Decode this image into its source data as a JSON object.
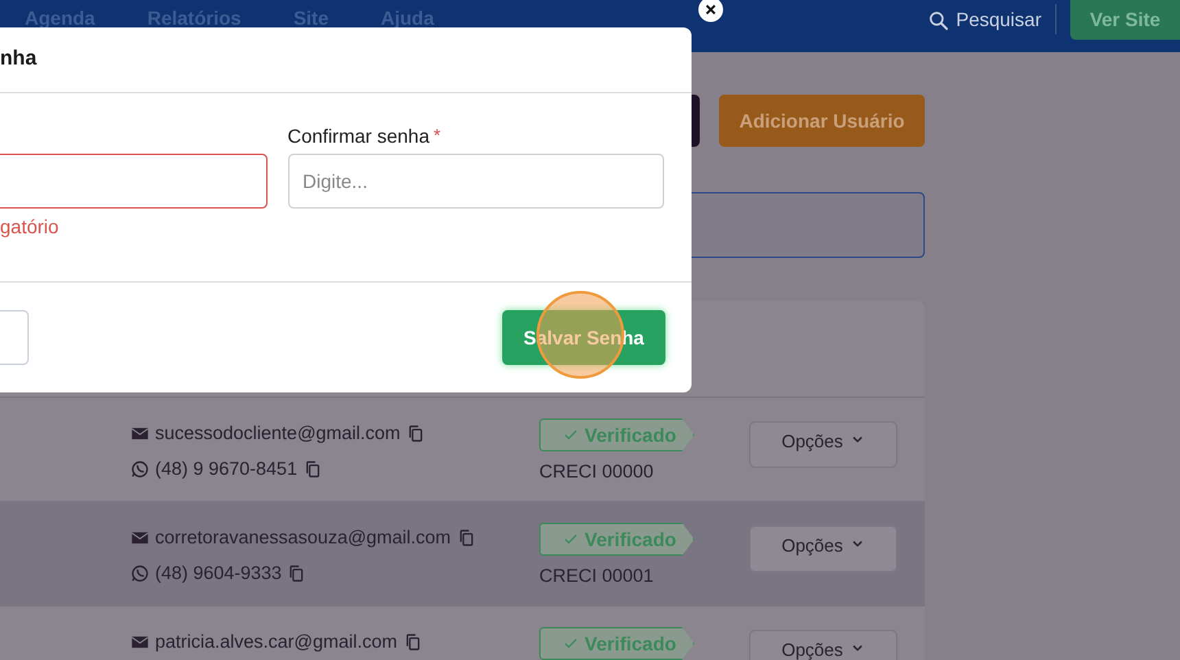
{
  "nav": {
    "items": [
      "Agenda",
      "Relatórios",
      "Site",
      "Ajuda"
    ],
    "search": "Pesquisar",
    "site_button": "Ver Site"
  },
  "toolbar": {
    "add_button": "Adicionar Usuário"
  },
  "users": [
    {
      "email": "sucessodocliente@gmail.com",
      "phone": "(48) 9 9670-8451",
      "status": "Verificado",
      "creci": "CRECI 00000",
      "options": "Opções",
      "highlighted": false
    },
    {
      "email": "corretoravanessasouza@gmail.com",
      "phone": "(48) 9604-9333",
      "status": "Verificado",
      "creci": "CRECI 00001",
      "options": "Opções",
      "highlighted": true
    },
    {
      "email": "patricia.alves.car@gmail.com",
      "status": "Verificado",
      "options": "Opções",
      "highlighted": false
    }
  ],
  "modal": {
    "title": "nha",
    "fields": [
      {
        "error": "gatório",
        "invalid": true
      },
      {
        "label": "Confirmar senha",
        "required_mark": "*",
        "placeholder": "Digite...",
        "invalid": false
      }
    ],
    "save_button": "Salvar Senha"
  }
}
